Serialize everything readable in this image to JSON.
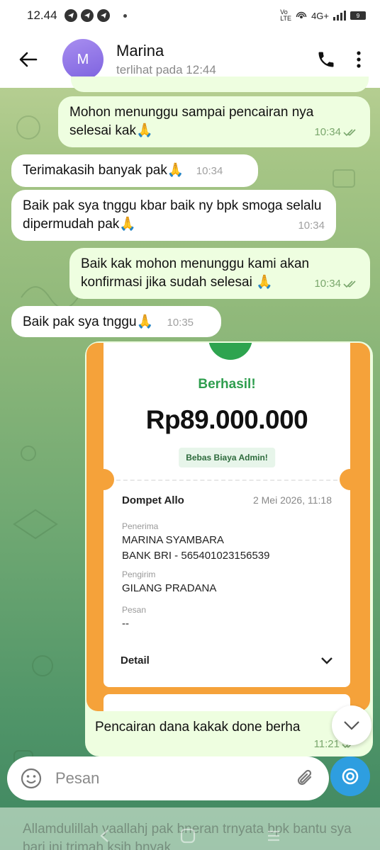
{
  "status_bar": {
    "time": "12.44",
    "network": "4G+",
    "battery": "9"
  },
  "header": {
    "contact_name": "Marina",
    "avatar_initial": "M",
    "last_seen": "terlihat pada  12:44"
  },
  "messages": [
    {
      "direction": "out",
      "text": "Mohon menunggu sampai pencairan nya selesai kak🙏",
      "time": "10:34"
    },
    {
      "direction": "in",
      "text": "Terimakasih banyak pak🙏",
      "time": "10:34"
    },
    {
      "direction": "in",
      "text": "Baik pak sya tnggu kbar baik ny bpk smoga selalu dipermudah pak🙏",
      "time": "10:34"
    },
    {
      "direction": "out",
      "text": "Baik kak mohon menunggu kami akan konfirmasi jika sudah selesai 🙏",
      "time": "10:34"
    },
    {
      "direction": "in",
      "text": "Baik pak sya tnggu🙏",
      "time": "10:35"
    }
  ],
  "receipt": {
    "status": "Berhasil!",
    "amount": "Rp89.000.000",
    "badge": "Bebas Biaya Admin!",
    "wallet": "Dompet Allo",
    "date": "2 Mei 2026, 11:18",
    "recipient_label": "Penerima",
    "recipient_name": "MARINA SYAMBARA",
    "recipient_bank": "BANK BRI - 565401023156539",
    "sender_label": "Pengirim",
    "sender_name": "GILANG PRADANA",
    "message_label": "Pesan",
    "message_value": "--",
    "detail_label": "Detail",
    "caption": "Pencairan dana kakak done berha",
    "time": "11:21"
  },
  "composer": {
    "placeholder": "Pesan"
  },
  "bottom_preview": "Allamdulillah yaallahj pak bneran trnyata bpk bantu sya bari ini trimah ksih bnyak",
  "colors": {
    "outgoing_bubble": "#eefee0",
    "incoming_bubble": "#ffffff",
    "accent": "#2e9ee0",
    "success_green": "#2e9e4e",
    "receipt_orange": "#f5a23a"
  }
}
